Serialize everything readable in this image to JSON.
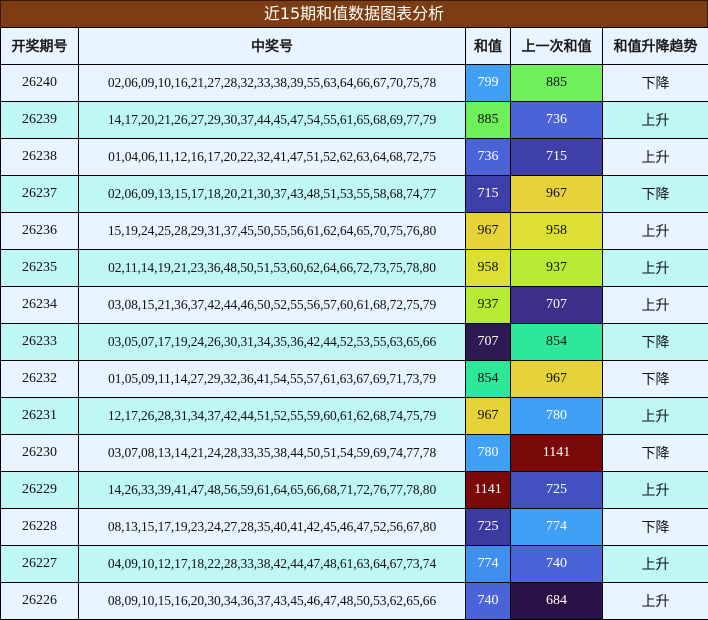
{
  "title": "近15期和值数据图表分析",
  "headers": [
    "开奖期号",
    "中奖号",
    "和值",
    "上一次和值",
    "和值升降趋势"
  ],
  "colors": {
    "title_bg": "#7d3d12",
    "header_bg": "#e8f4ff",
    "row_odd_bg": "#e8f4ff",
    "row_even_bg": "#bff7f5",
    "light_text": "#ffffff",
    "dark_text": "#111111"
  },
  "rows": [
    {
      "period": "26240",
      "numbers": "02,06,09,10,16,21,27,28,32,33,38,39,55,63,64,66,67,70,75,78",
      "sum": "799",
      "sum_bg": "#3fa0f5",
      "sum_fg": "#ffffff",
      "prev": "885",
      "prev_bg": "#6df05a",
      "prev_fg": "#111111",
      "trend": "下降"
    },
    {
      "period": "26239",
      "numbers": "14,17,20,21,26,27,29,30,37,44,45,47,54,55,61,65,68,69,77,79",
      "sum": "885",
      "sum_bg": "#6df05a",
      "sum_fg": "#111111",
      "prev": "736",
      "prev_bg": "#4a64d8",
      "prev_fg": "#ffffff",
      "trend": "上升"
    },
    {
      "period": "26238",
      "numbers": "01,04,06,11,12,16,17,20,22,32,41,47,51,52,62,63,64,68,72,75",
      "sum": "736",
      "sum_bg": "#4a64d8",
      "sum_fg": "#ffffff",
      "prev": "715",
      "prev_bg": "#3e3fa8",
      "prev_fg": "#ffffff",
      "trend": "上升"
    },
    {
      "period": "26237",
      "numbers": "02,06,09,13,15,17,18,20,21,30,37,43,48,51,53,55,58,68,74,77",
      "sum": "715",
      "sum_bg": "#3e3fa8",
      "sum_fg": "#ffffff",
      "prev": "967",
      "prev_bg": "#e6d33a",
      "prev_fg": "#111111",
      "trend": "下降"
    },
    {
      "period": "26236",
      "numbers": "15,19,24,25,28,29,31,37,45,50,55,56,61,62,64,65,70,75,76,80",
      "sum": "967",
      "sum_bg": "#e6d33a",
      "sum_fg": "#111111",
      "prev": "958",
      "prev_bg": "#dce035",
      "prev_fg": "#111111",
      "trend": "上升"
    },
    {
      "period": "26235",
      "numbers": "02,11,14,19,21,23,36,48,50,51,53,60,62,64,66,72,73,75,78,80",
      "sum": "958",
      "sum_bg": "#dce035",
      "sum_fg": "#111111",
      "prev": "937",
      "prev_bg": "#b8ec34",
      "prev_fg": "#111111",
      "trend": "上升"
    },
    {
      "period": "26234",
      "numbers": "03,08,15,21,36,37,42,44,46,50,52,55,56,57,60,61,68,72,75,79",
      "sum": "937",
      "sum_bg": "#b8ec34",
      "sum_fg": "#111111",
      "prev": "707",
      "prev_bg": "#3c2f8a",
      "prev_fg": "#ffffff",
      "trend": "上升"
    },
    {
      "period": "26233",
      "numbers": "03,05,07,17,19,24,26,30,31,34,35,36,42,44,52,53,55,63,65,66",
      "sum": "707",
      "sum_bg": "#2e1a52",
      "sum_fg": "#ffffff",
      "prev": "854",
      "prev_bg": "#2ee89a",
      "prev_fg": "#111111",
      "trend": "下降"
    },
    {
      "period": "26232",
      "numbers": "01,05,09,11,14,27,29,32,36,41,54,55,57,61,63,67,69,71,73,79",
      "sum": "854",
      "sum_bg": "#2ee89a",
      "sum_fg": "#111111",
      "prev": "967",
      "prev_bg": "#e6d33a",
      "prev_fg": "#111111",
      "trend": "下降"
    },
    {
      "period": "26231",
      "numbers": "12,17,26,28,31,34,37,42,44,51,52,55,59,60,61,62,68,74,75,79",
      "sum": "967",
      "sum_bg": "#e6d33a",
      "sum_fg": "#111111",
      "prev": "780",
      "prev_bg": "#3fa0f5",
      "prev_fg": "#ffffff",
      "trend": "上升"
    },
    {
      "period": "26230",
      "numbers": "03,07,08,13,14,21,24,28,33,35,38,44,50,51,54,59,69,74,77,78",
      "sum": "780",
      "sum_bg": "#3fa0f5",
      "sum_fg": "#ffffff",
      "prev": "1141",
      "prev_bg": "#7a0a0a",
      "prev_fg": "#ffffff",
      "trend": "下降"
    },
    {
      "period": "26229",
      "numbers": "14,26,33,39,41,47,48,56,59,61,64,65,66,68,71,72,76,77,78,80",
      "sum": "1141",
      "sum_bg": "#7a0a0a",
      "sum_fg": "#ffffff",
      "prev": "725",
      "prev_bg": "#4250c0",
      "prev_fg": "#ffffff",
      "trend": "上升"
    },
    {
      "period": "26228",
      "numbers": "08,13,15,17,19,23,24,27,28,35,40,41,42,45,46,47,52,56,67,80",
      "sum": "725",
      "sum_bg": "#3c3aa0",
      "sum_fg": "#ffffff",
      "prev": "774",
      "prev_bg": "#3fa0f5",
      "prev_fg": "#ffffff",
      "trend": "下降"
    },
    {
      "period": "26227",
      "numbers": "04,09,10,12,17,18,22,28,33,38,42,44,47,48,61,63,64,67,73,74",
      "sum": "774",
      "sum_bg": "#3f90ee",
      "sum_fg": "#ffffff",
      "prev": "740",
      "prev_bg": "#4a64d8",
      "prev_fg": "#ffffff",
      "trend": "上升"
    },
    {
      "period": "26226",
      "numbers": "08,09,10,15,16,20,30,34,36,37,43,45,46,47,48,50,53,62,65,66",
      "sum": "740",
      "sum_bg": "#4a64d8",
      "sum_fg": "#ffffff",
      "prev": "684",
      "prev_bg": "#2b1246",
      "prev_fg": "#ffffff",
      "trend": "上升"
    }
  ]
}
